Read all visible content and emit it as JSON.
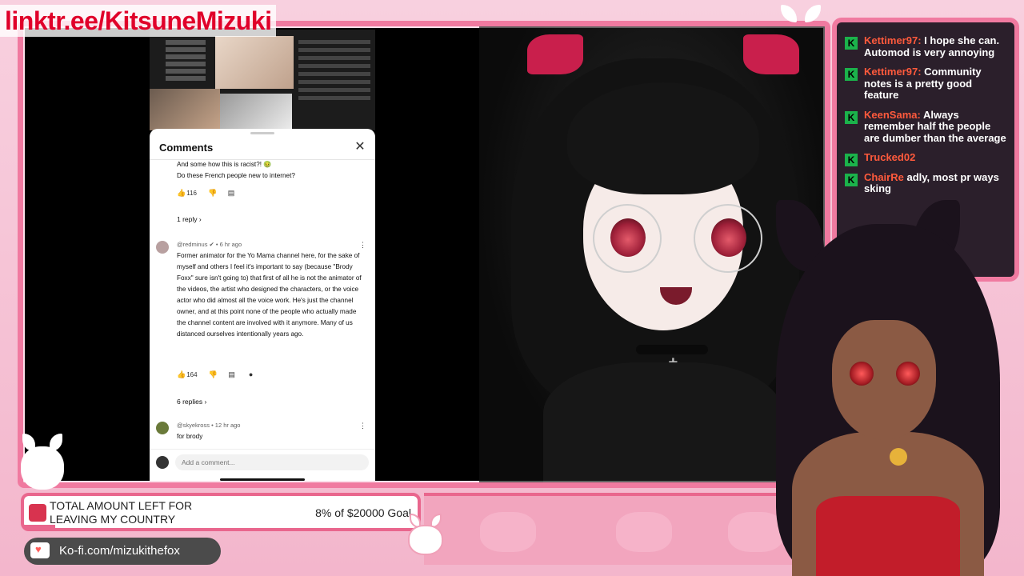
{
  "overlay": {
    "link": "linktr.ee/KitsuneMizuki",
    "kofi": "Ko-fi.com/mizukithefox",
    "goal": {
      "label": "TOTAL AMOUNT LEFT FOR LEAVING MY COUNTRY",
      "amount": "8% of $20000 Goal",
      "progress_percent": 8
    }
  },
  "comments_panel": {
    "title": "Comments",
    "first_comment": {
      "text_line1": "And some how this is racist?! 🤢",
      "text_line2": "Do these French people new to internet?",
      "likes": "116",
      "replies": "1 reply"
    },
    "second_comment": {
      "author": "@redminus",
      "time": "• 6 hr ago",
      "text": "Former animator for the Yo Mama channel here, for the sake of myself and others I feel it's important to say (because \"Brody Foxx\" sure isn't going to) that first of all he is not the animator of the videos, the artist who designed the characters, or the voice actor who did almost all the voice work. He's just the channel owner, and at this point none of the people who actually made the channel content are involved with it anymore. Many of us distanced ourselves intentionally years ago.",
      "likes": "164",
      "replies": "6 replies"
    },
    "third_comment": {
      "author": "@skyekross",
      "time": "• 12 hr ago",
      "text": "for brody"
    },
    "add_comment_placeholder": "Add a comment..."
  },
  "chat": {
    "messages": [
      {
        "user": "Kettimer97:",
        "text": "I hope she can. Automod is very annoying"
      },
      {
        "user": "Kettimer97:",
        "text": "Community notes is a pretty good feature"
      },
      {
        "user": "KeenSama:",
        "text": "Always remember half the people are dumber than the average"
      },
      {
        "user": "Trucked02",
        "text": ""
      },
      {
        "user": "ChairRe",
        "text": "adly, most pr    ways     sking"
      }
    ],
    "badge": "K"
  },
  "colors": {
    "frame": "#f07aa0",
    "chat_user": "#ff5a3c",
    "badge": "#1bb24b",
    "link": "#e0002a"
  }
}
